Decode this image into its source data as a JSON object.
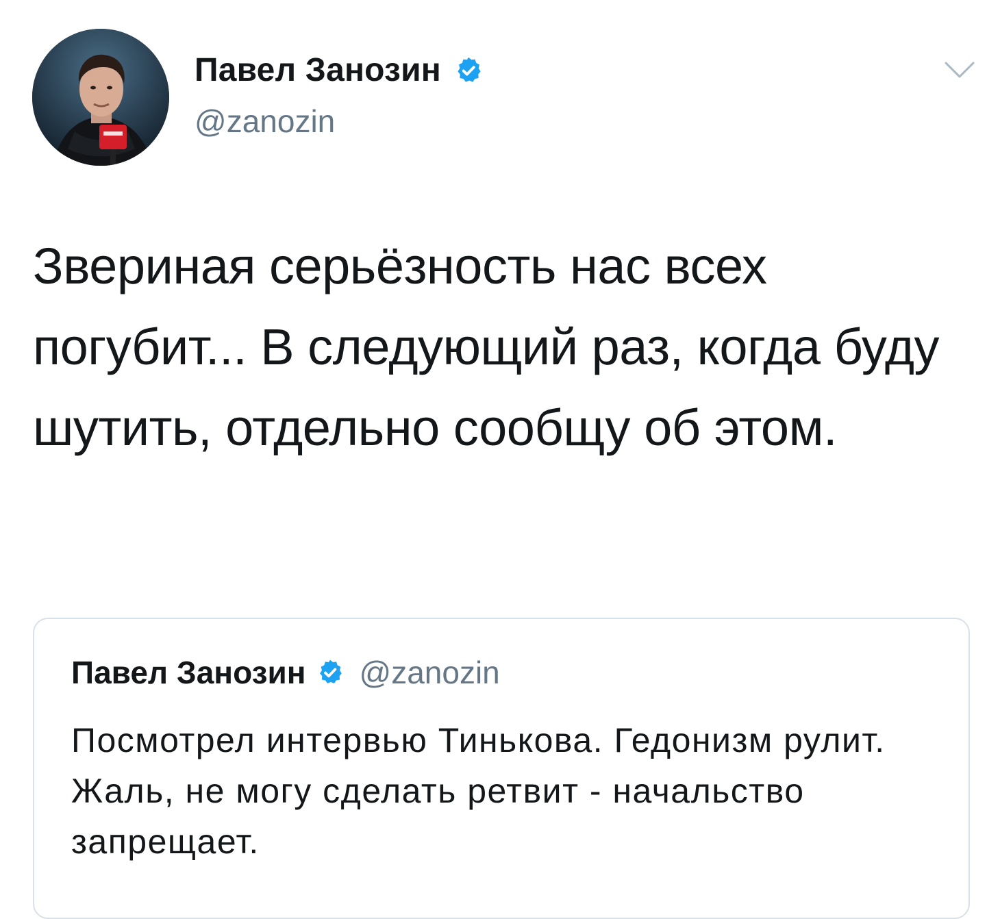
{
  "tweet": {
    "author": {
      "display_name": "Павел Занозин",
      "handle": "@zanozin",
      "verified_icon": "verified-badge-icon",
      "avatar_icon": "avatar-photo"
    },
    "menu_icon": "chevron-down-icon",
    "text": "Звериная серьёзность нас всех погубит... В следующий раз, когда буду шутить, отдельно сообщу об этом."
  },
  "quoted_tweet": {
    "author": {
      "display_name": "Павел Занозин",
      "handle": "@zanozin",
      "verified_icon": "verified-badge-icon"
    },
    "text": "Посмотрел интервью Тинькова. Гедонизм рулит. Жаль, не могу сделать ретвит - начальство запрещает."
  },
  "colors": {
    "text_primary": "#14171a",
    "text_secondary": "#657786",
    "verified_blue": "#1da1f2",
    "border": "#d9e1e8",
    "caret": "#aab8c2"
  }
}
